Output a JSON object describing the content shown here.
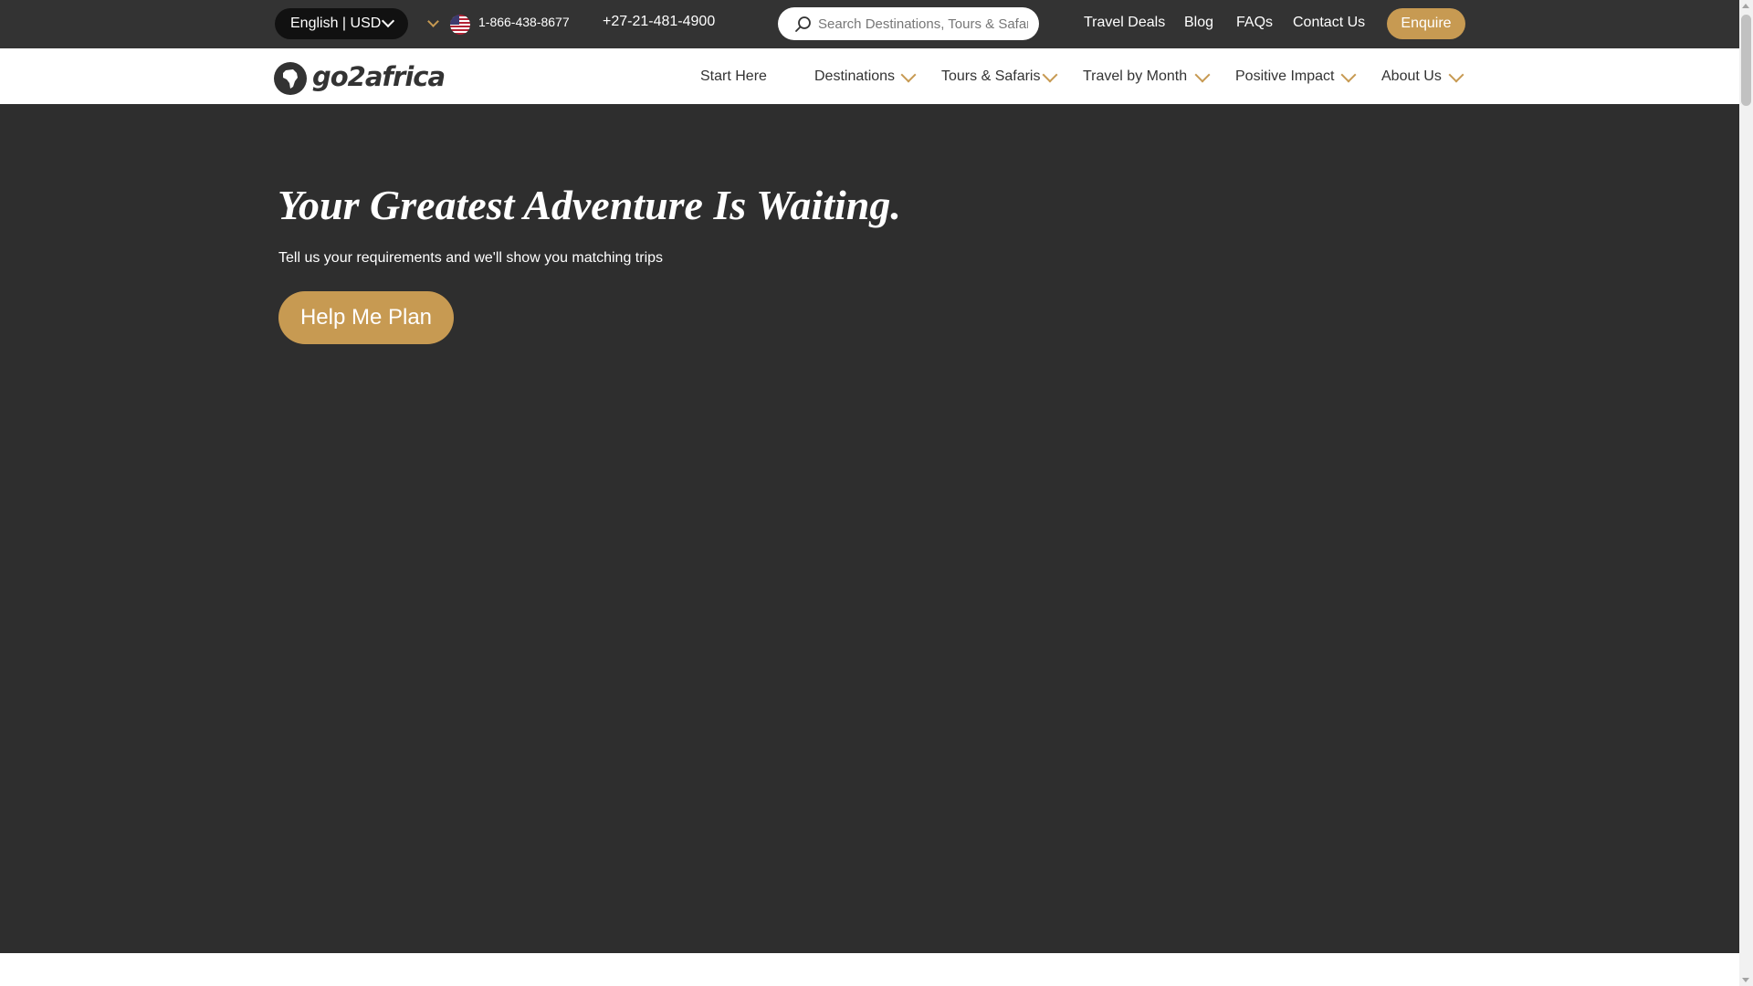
{
  "topbar": {
    "language_currency": "English | USD",
    "phone_us": "1-866-438-8677",
    "phone_intl": "+27-21-481-4900",
    "search_placeholder": "Search Destinations, Tours & Safaris",
    "links": [
      "Travel Deals",
      "Blog",
      "FAQs",
      "Contact Us"
    ],
    "enquire_label": "Enquire",
    "flag_icon": "us-flag-icon"
  },
  "nav": {
    "logo_text": "go2africa",
    "items": [
      "Start Here",
      "Destinations",
      "Tours & Safaris",
      "Travel by Month",
      "Positive Impact",
      "About Us"
    ]
  },
  "hero": {
    "title": "Your Greatest Adventure Is Waiting.",
    "subtitle": "Tell us your requirements and we'll show you matching trips",
    "cta_label": "Help Me Plan"
  },
  "colors": {
    "accent": "#c79a52",
    "topbar_bg": "#333333",
    "hero_bg": "#2e2e2e"
  }
}
